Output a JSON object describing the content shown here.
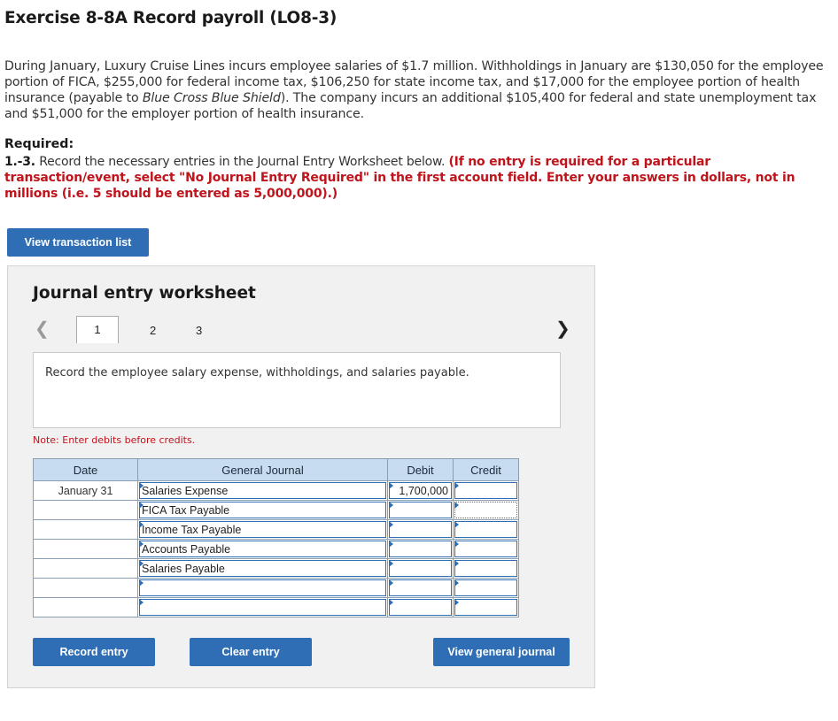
{
  "title": "Exercise 8-8A Record payroll (LO8-3)",
  "problem": {
    "part1": "During January, Luxury Cruise Lines incurs employee salaries of $1.7 million. Withholdings in January are $130,050 for the employee portion of FICA, $255,000 for federal income tax, $106,250 for state income tax, and $17,000 for the employee portion of health insurance (payable to ",
    "italic": "Blue Cross Blue Shield",
    "part2": "). The company incurs an additional $105,400 for federal and state unemployment tax and $51,000 for the employer portion of health insurance."
  },
  "required": {
    "heading": "Required:",
    "number": "1.-3.",
    "text": " Record the necessary entries in the Journal Entry Worksheet below. ",
    "red_text": "(If no entry is required for a particular transaction/event, select \"No Journal Entry Required\" in the first account field. Enter your answers in dollars, not in millions (i.e. 5 should be entered as 5,000,000).)"
  },
  "buttons": {
    "view_transaction_list": "View transaction list",
    "record_entry": "Record entry",
    "clear_entry": "Clear entry",
    "view_general_journal": "View general journal"
  },
  "worksheet": {
    "title": "Journal entry worksheet",
    "tabs": [
      "1",
      "2",
      "3"
    ],
    "active_tab": "1",
    "description": "Record the employee salary expense, withholdings, and salaries payable.",
    "note": "Note: Enter debits before credits.",
    "columns": [
      "Date",
      "General Journal",
      "Debit",
      "Credit"
    ],
    "rows": [
      {
        "date": "January 31",
        "account": "Salaries Expense",
        "debit": "1,700,000",
        "credit": ""
      },
      {
        "date": "",
        "account": "FICA Tax Payable",
        "debit": "",
        "credit": ""
      },
      {
        "date": "",
        "account": "Income Tax Payable",
        "debit": "",
        "credit": ""
      },
      {
        "date": "",
        "account": "Accounts Payable",
        "debit": "",
        "credit": ""
      },
      {
        "date": "",
        "account": "Salaries Payable",
        "debit": "",
        "credit": ""
      },
      {
        "date": "",
        "account": "",
        "debit": "",
        "credit": ""
      },
      {
        "date": "",
        "account": "",
        "debit": "",
        "credit": ""
      }
    ]
  },
  "colors": {
    "accent": "#2f6eb5",
    "header_bg": "#c8dcf1",
    "warning_red": "#c0141c"
  }
}
